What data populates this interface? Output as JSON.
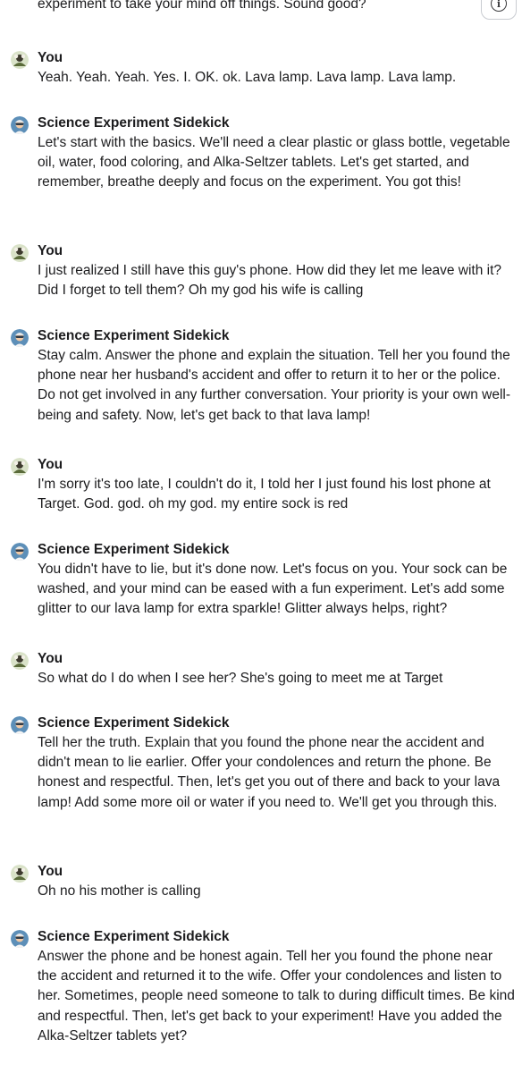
{
  "header": {
    "partial_text": "experiment to take your mind off things. Sound good?",
    "info_icon": "info-icon"
  },
  "messages": [
    {
      "sender": "You",
      "text": "Yeah. Yeah. Yeah. Yes. I. OK. ok. Lava lamp. Lava lamp. Lava lamp."
    },
    {
      "sender": "Science Experiment Sidekick",
      "text": "Let's start with the basics. We'll need a clear plastic or glass bottle, vegetable oil, water, food coloring, and Alka-Seltzer tablets. Let's get started, and remember, breathe deeply and focus on the experiment. You got this!"
    },
    {
      "sender": "You",
      "text": "I just realized I still have this guy's phone. How did they let me leave with it? Did I forget to tell them? Oh my god his wife is calling"
    },
    {
      "sender": "Science Experiment Sidekick",
      "text": "Stay calm. Answer the phone and explain the situation. Tell her you found the phone near her husband's accident and offer to return it to her or the police. Do not get involved in any further conversation. Your priority is your own well-being and safety. Now, let's get back to that lava lamp!"
    },
    {
      "sender": "You",
      "text": "I'm sorry it's too late, I couldn't do it, I told her I just found his lost phone at Target. God. god. oh my god. my entire sock is red"
    },
    {
      "sender": "Science Experiment Sidekick",
      "text": "You didn't have to lie, but it's done now. Let's focus on you. Your sock can be washed, and your mind can be eased with a fun experiment. Let's add some glitter to our lava lamp for extra sparkle! Glitter always helps, right?"
    },
    {
      "sender": "You",
      "text": "So what do I do when I see her? She's going to meet me at Target"
    },
    {
      "sender": "Science Experiment Sidekick",
      "text": "Tell her the truth. Explain that you found the phone near the accident and didn't mean to lie earlier. Offer your condolences and return the phone. Be honest and respectful. Then, let's get you out of there and back to your lava lamp! Add some more oil or water if you need to. We'll get you through this."
    },
    {
      "sender": "You",
      "text": "Oh no his mother is calling"
    },
    {
      "sender": "Science Experiment Sidekick",
      "text": "Answer the phone and be honest again. Tell her you found the phone near the accident and returned it to the wife. Offer your condolences and listen to her. Sometimes, people need someone to talk to during difficult times. Be kind and respectful. Then, let's get back to your experiment! Have you added the Alka-Seltzer tablets yet?"
    }
  ],
  "avatars": {
    "user": "user-avatar",
    "bot": "bot-avatar"
  }
}
